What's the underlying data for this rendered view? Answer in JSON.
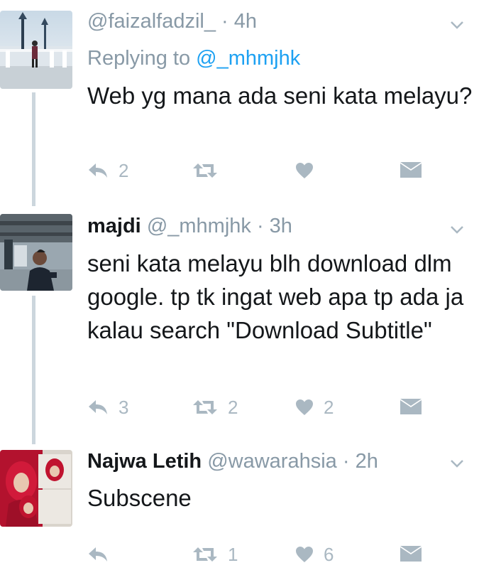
{
  "tweets": [
    {
      "handle": "@faizalfadzil_",
      "time": "· 4h",
      "replying_prefix": "Replying to",
      "replying_to": "@_mhmjhk",
      "text": "Web yg mana ada seni kata melayu?",
      "counts": {
        "reply": "2",
        "retweet": "",
        "like": ""
      }
    },
    {
      "name": "majdi",
      "handle": "@_mhmjhk",
      "time": "· 3h",
      "text": "seni kata melayu blh download dlm google. tp tk ingat web apa tp ada ja kalau search \"Download Subtitle\"",
      "counts": {
        "reply": "3",
        "retweet": "2",
        "like": "2"
      }
    },
    {
      "name": "Najwa Letih",
      "handle": "@wawarahsia",
      "time": "· 2h",
      "text": "Subscene",
      "counts": {
        "reply": "",
        "retweet": "1",
        "like": "6"
      }
    }
  ],
  "colors": {
    "icon_gray": "#aab8c2",
    "mention_blue": "#1da1f2",
    "meta_gray": "#8899a6",
    "thread_line": "#ccd6dd"
  },
  "icons": [
    "chevron-down-icon",
    "reply-icon",
    "retweet-icon",
    "heart-icon",
    "dm-envelope-icon"
  ]
}
